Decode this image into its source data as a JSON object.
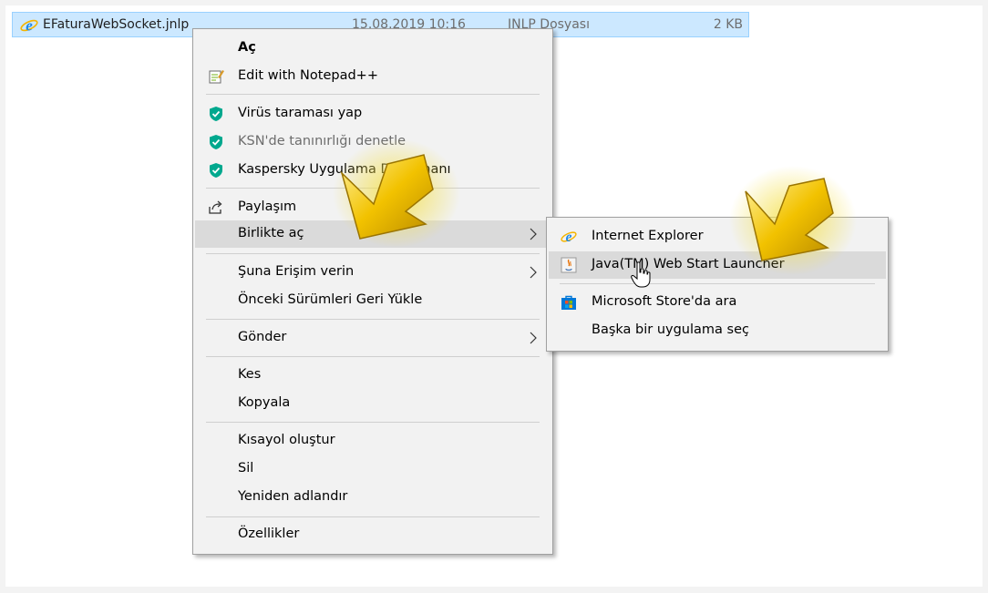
{
  "file": {
    "name": "EFaturaWebSocket.jnlp",
    "date": "15.08.2019 10:16",
    "type": "JNLP Dosyası",
    "size": "2 KB",
    "icon": "internet-explorer-icon"
  },
  "context_menu": {
    "open": "Aç",
    "edit_notepad": "Edit with Notepad++",
    "virus_scan": "Virüs taraması yap",
    "ksn_check": "KSN'de tanınırlığı denetle",
    "kaspersky_app": "Kaspersky Uygulama Danışmanı",
    "share": "Paylaşım",
    "open_with": "Birlikte aç",
    "give_access": "Şuna Erişim verin",
    "restore_versions": "Önceki Sürümleri Geri Yükle",
    "send_to": "Gönder",
    "cut": "Kes",
    "copy": "Kopyala",
    "create_shortcut": "Kısayol oluştur",
    "delete": "Sil",
    "rename": "Yeniden adlandır",
    "properties": "Özellikler"
  },
  "open_with_submenu": {
    "internet_explorer": "Internet Explorer",
    "java_launcher": "Java(TM) Web Start Launcher",
    "store_search": "Microsoft Store'da ara",
    "choose_other": "Başka bir uygulama seç"
  },
  "colors": {
    "selection": "#cce8ff",
    "menu_bg": "#f2f2f2",
    "highlight": "#dadada",
    "kaspersky_green": "#00a88e",
    "annotation_gold": "#f2c200"
  }
}
